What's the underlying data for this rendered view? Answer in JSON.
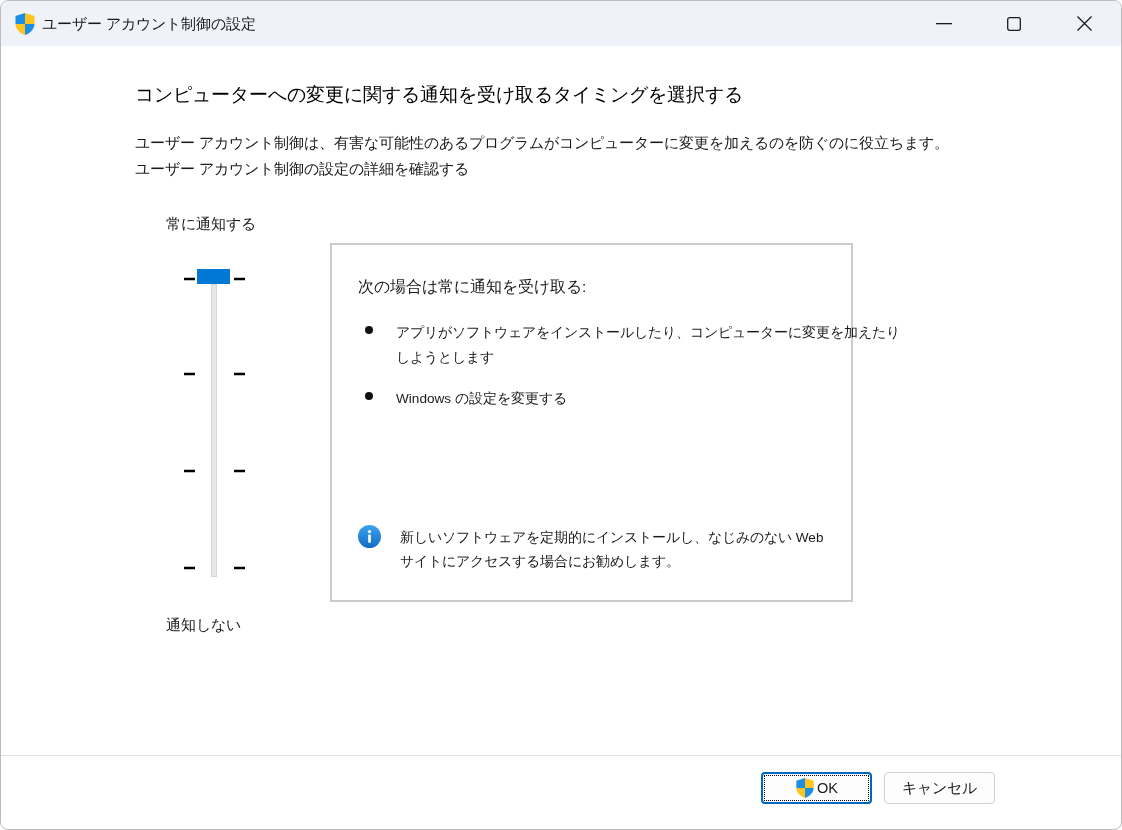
{
  "window": {
    "title": "ユーザー アカウント制御の設定"
  },
  "heading": "コンピューターへの変更に関する通知を受け取るタイミングを選択する",
  "description": "ユーザー アカウント制御は、有害な可能性のあるプログラムがコンピューターに変更を加えるのを防ぐのに役立ちます。",
  "details_link": "ユーザー アカウント制御の設定の詳細を確認する",
  "slider": {
    "top_label": "常に通知する",
    "level": 1,
    "bottom_label": "通知しない"
  },
  "info_panel": {
    "title": "次の場合は常に通知を受け取る:",
    "bullets": [
      "アプリがソフトウェアをインストールしたり、コンピューターに変更を加えたりしようとします",
      "Windows の設定を変更する"
    ],
    "note": "新しいソフトウェアを定期的にインストールし、なじみのない Web サイトにアクセスする場合にお勧めします。"
  },
  "buttons": [
    {
      "label": "OK",
      "kind": "elevated",
      "focused": true
    },
    {
      "label": "キャンセル",
      "kind": "plain",
      "focused": false
    }
  ]
}
